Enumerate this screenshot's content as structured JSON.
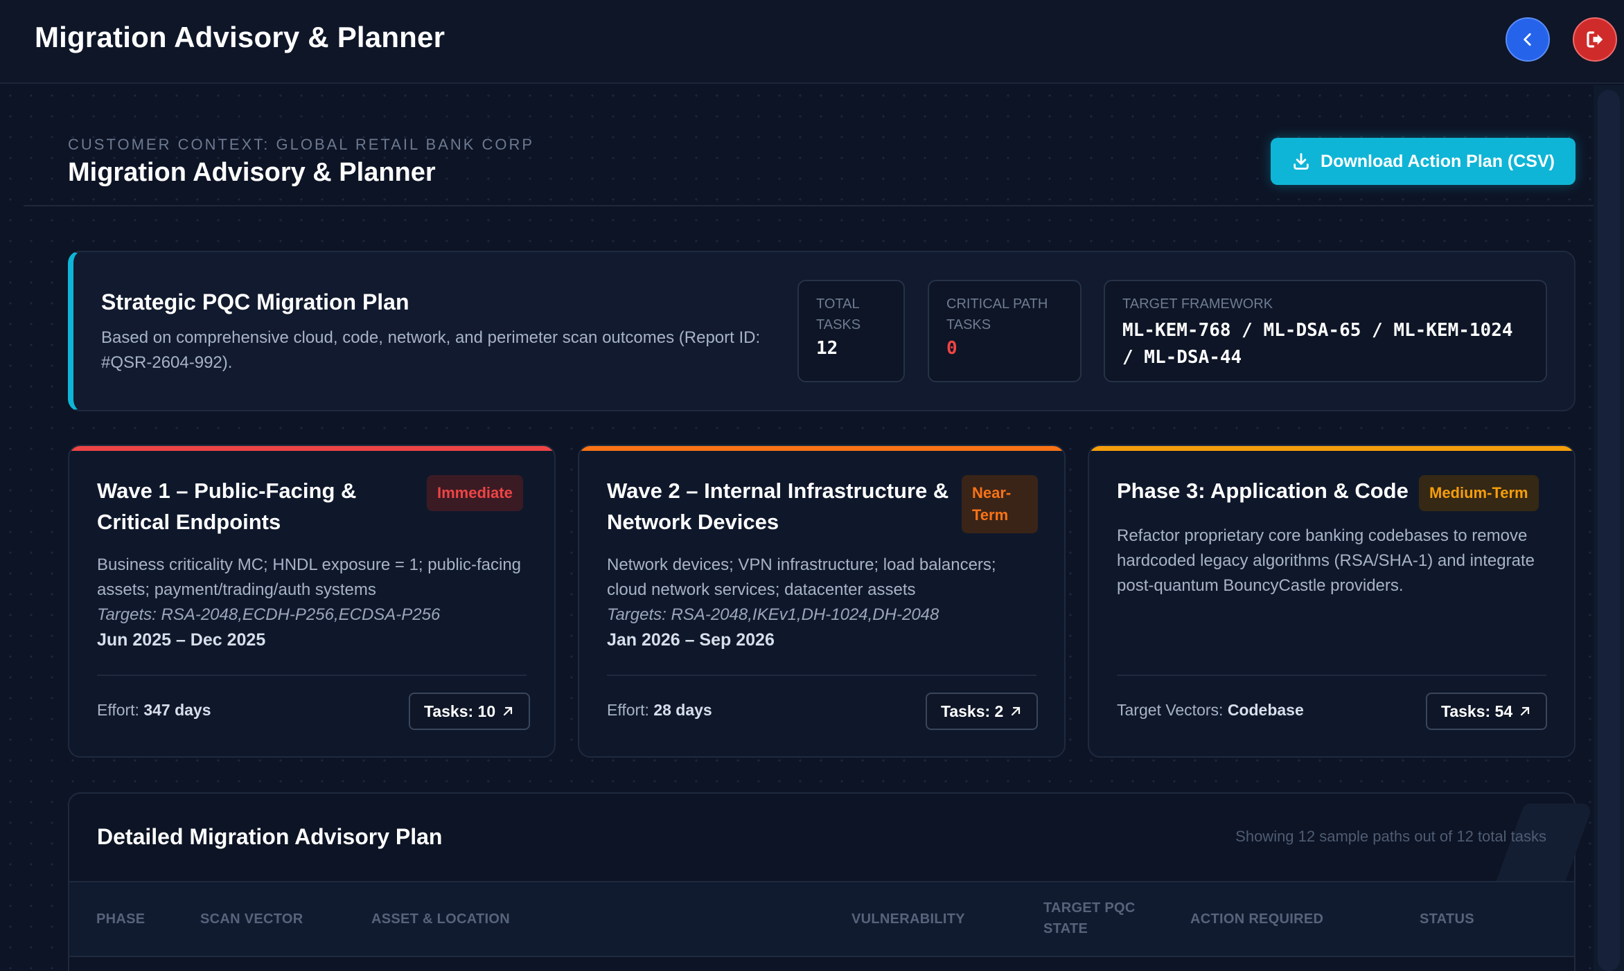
{
  "app": {
    "title": "Migration Advisory & Planner",
    "back_icon": "chevron-left-icon",
    "logout_icon": "logout-icon"
  },
  "header": {
    "eyebrow": "CUSTOMER CONTEXT: GLOBAL RETAIL BANK CORP",
    "title": "Migration Advisory & Planner",
    "download_label": "Download Action Plan (CSV)",
    "download_icon": "download-icon"
  },
  "plan": {
    "title": "Strategic PQC Migration Plan",
    "description": "Based on comprehensive cloud, code, network, and perimeter scan outcomes (Report ID: #QSR-2604-992).",
    "stats": [
      {
        "label": "TOTAL TASKS",
        "value": "12"
      },
      {
        "label": "CRITICAL PATH TASKS",
        "value": "0"
      }
    ],
    "framework_label": "TARGET FRAMEWORK",
    "framework_value": "ML-KEM-768 / ML-DSA-65 / ML-KEM-1024 / ML-DSA-44"
  },
  "waves": [
    {
      "title": "Wave 1 – Public-Facing & Critical Endpoints",
      "badge": "Immediate",
      "description": "Business criticality MC; HNDL exposure = 1; public-facing assets; payment/trading/auth systems",
      "targets": "Targets: RSA-2048,ECDH-P256,ECDSA-P256",
      "dates": "Jun 2025 – Dec 2025",
      "foot_label": "Effort: ",
      "foot_value": "347 days",
      "tasks_label": "Tasks: 10"
    },
    {
      "title": "Wave 2 – Internal Infrastructure & Network Devices",
      "badge": "Near-Term",
      "description": "Network devices; VPN infrastructure; load balancers; cloud network services; datacenter assets",
      "targets": "Targets: RSA-2048,IKEv1,DH-1024,DH-2048",
      "dates": "Jan 2026 – Sep 2026",
      "foot_label": "Effort: ",
      "foot_value": "28 days",
      "tasks_label": "Tasks: 2"
    },
    {
      "title": "Phase 3: Application & Code",
      "badge": "Medium-Term",
      "description": "Refactor proprietary core banking codebases to remove hardcoded legacy algorithms (RSA/SHA-1) and integrate post-quantum BouncyCastle providers.",
      "foot_label": "Target Vectors: ",
      "foot_value": "Codebase",
      "tasks_label": "Tasks: 54"
    }
  ],
  "colors": {
    "accent": "#0fb5d6",
    "wave1": "#ef4444",
    "wave2": "#f97316",
    "wave3": "#f59e0b",
    "critical_value": "#ef4444"
  },
  "table": {
    "title": "Detailed Migration Advisory Plan",
    "meta": "Showing 12 sample paths out of 12 total tasks",
    "columns": [
      "PHASE",
      "SCAN VECTOR",
      "ASSET & LOCATION",
      "VULNERABILITY",
      "TARGET PQC STATE",
      "ACTION REQUIRED",
      "STATUS"
    ]
  }
}
